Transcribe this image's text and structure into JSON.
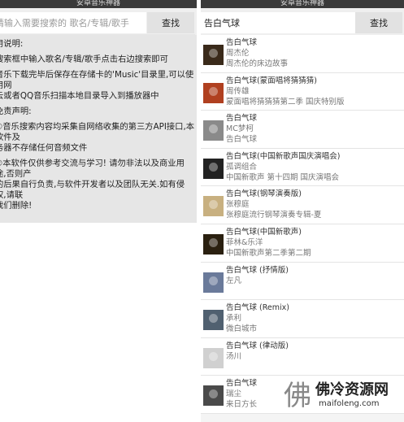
{
  "left": {
    "window_title": "安卓音乐神器",
    "search": {
      "placeholder": "请输入需要搜索的 歌名/专辑/歌手",
      "button": "查找"
    },
    "instructions": [
      "用说明:",
      "搜索框中输入歌名/专辑/歌手点击右边搜索即可",
      "音乐下载完毕后保存在存储卡的'Music'目录里,可以使用网\n云或者QQ音乐扫描本地目录导入到播放器中",
      "免责声明:",
      "①音乐搜索内容均采集自网络收集的第三方API接口,本软件及\n务器不存储任何音频文件",
      "②本软件仅供参考交流与学习! 请勿非法以及商业用途,否则产\n的后果自行负责,与软件开发者以及团队无关.如有侵权,请联\n我们删除!"
    ]
  },
  "right": {
    "window_title": "安卓音乐神器",
    "search": {
      "value": "告白气球",
      "button": "查找"
    },
    "results": [
      {
        "title": "告白气球",
        "artist": "周杰伦",
        "album": "周杰伦的床边故事",
        "color": "#3a2a1a"
      },
      {
        "title": "告白气球(蒙面唱将猜猜猜)",
        "artist": "周传雄",
        "album": "蒙面唱将猜猜猜第二季 国庆特别版",
        "color": "#b04020"
      },
      {
        "title": "告白气球",
        "artist": "MC梦柯",
        "album": "告白气球",
        "color": "#8a8a8a"
      },
      {
        "title": "告白气球(中国新歌声国庆演唱会)",
        "artist": "孤调组合",
        "album": "中国新歌声 第十四期 国庆演唱会",
        "color": "#222222"
      },
      {
        "title": "告白气球(钢琴演奏版)",
        "artist": "张穆庭",
        "album": "张穆庭流行钢琴演奏专辑-夏",
        "color": "#c8b080"
      },
      {
        "title": "告白气球(中国新歌声)",
        "artist": "菲林&乐洋",
        "album": "中国新歌声第二季第二期",
        "color": "#2a2010"
      },
      {
        "title": "告白气球 (抒情版)",
        "artist": "左凡",
        "album": "",
        "color": "#6a7a9a"
      },
      {
        "title": "告白气球 (Remix)",
        "artist": "承利",
        "album": "微白城市",
        "color": "#506070"
      },
      {
        "title": "告白气球 (律动版)",
        "artist": "汤川",
        "album": "",
        "color": "#d0d0d0"
      },
      {
        "title": "告白气球",
        "artist": "瑞尘",
        "album": "来日方长",
        "color": "#4a4a4a"
      }
    ]
  },
  "watermark": {
    "logo": "佛",
    "name": "佛冷资源网",
    "url": "maifoleng.com"
  }
}
